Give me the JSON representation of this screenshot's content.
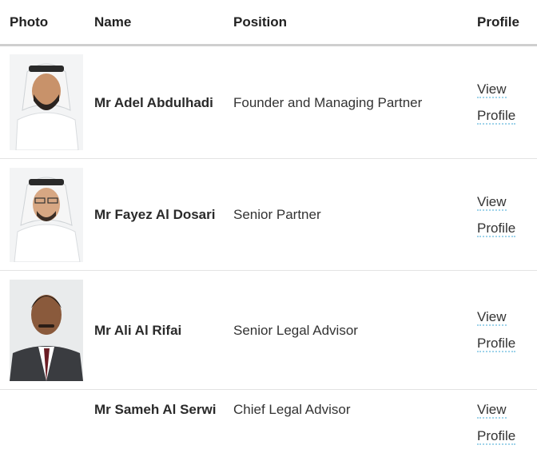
{
  "headers": {
    "photo": "Photo",
    "name": "Name",
    "position": "Position",
    "profile": "Profile"
  },
  "rows": [
    {
      "name": "Mr Adel Abdulhadi",
      "position": "Founder and Managing Partner",
      "link_line1": "View",
      "link_line2": "Profile"
    },
    {
      "name": "Mr Fayez Al Dosari",
      "position": "Senior Partner",
      "link_line1": "View",
      "link_line2": "Profile"
    },
    {
      "name": "Mr Ali Al Rifai",
      "position": "Senior Legal Advisor",
      "link_line1": "View",
      "link_line2": "Profile"
    },
    {
      "name": "Mr Sameh Al Serwi",
      "position": "Chief Legal Advisor",
      "link_line1": "View",
      "link_line2": "Profile"
    }
  ]
}
